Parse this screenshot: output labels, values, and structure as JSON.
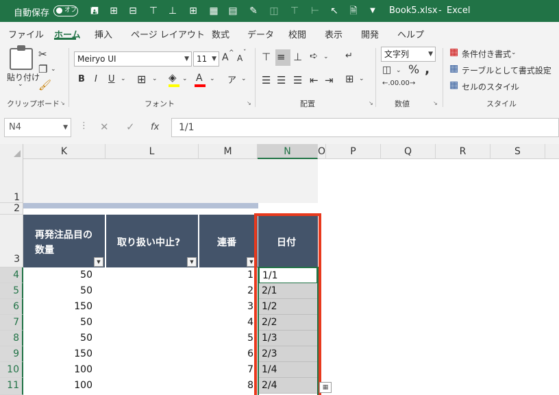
{
  "titlebar": {
    "autosave_label": "自動保存",
    "autosave_state": "オフ",
    "filename": "Book5.xlsx",
    "separator": "-",
    "app": "Excel"
  },
  "tabs": [
    "ファイル",
    "ホーム",
    "挿入",
    "ページ レイアウト",
    "数式",
    "データ",
    "校閲",
    "表示",
    "開発",
    "ヘルプ"
  ],
  "active_tab": "ホーム",
  "ribbon": {
    "clipboard": {
      "label": "クリップボード",
      "paste": "貼り付け"
    },
    "font": {
      "label": "フォント",
      "family": "Meiryo UI",
      "size": "11",
      "bold": "B",
      "italic": "I",
      "underline": "U",
      "grow": "A",
      "shrink": "A"
    },
    "alignment": {
      "label": "配置"
    },
    "number": {
      "label": "数値",
      "format": "文字列",
      "percent": "%",
      "comma": ","
    },
    "styles": {
      "label": "スタイル",
      "conditional": "条件付き書式",
      "as_table": "テーブルとして書式設定",
      "cell_styles": "セルのスタイル"
    }
  },
  "formula_bar": {
    "name_box": "N4",
    "fx": "fx",
    "value": "1/1"
  },
  "columns": [
    {
      "id": "K",
      "selected": false
    },
    {
      "id": "L",
      "selected": false
    },
    {
      "id": "M",
      "selected": false
    },
    {
      "id": "N",
      "selected": true
    },
    {
      "id": "O",
      "selected": false
    },
    {
      "id": "P",
      "selected": false
    },
    {
      "id": "Q",
      "selected": false
    },
    {
      "id": "R",
      "selected": false
    },
    {
      "id": "S",
      "selected": false
    }
  ],
  "rows": [
    "1",
    "2",
    "3",
    "4",
    "5",
    "6",
    "7",
    "8",
    "9",
    "10",
    "11"
  ],
  "table": {
    "headers": {
      "col_k_line1": "再発注品目の",
      "col_k_line2": "数量",
      "col_l": "取り扱い中止?",
      "col_m": "連番",
      "col_n": "日付"
    },
    "data": [
      {
        "qty": "50",
        "seq": "1",
        "date": "1/1"
      },
      {
        "qty": "50",
        "seq": "2",
        "date": "2/1"
      },
      {
        "qty": "150",
        "seq": "3",
        "date": "1/2"
      },
      {
        "qty": "50",
        "seq": "4",
        "date": "2/2"
      },
      {
        "qty": "50",
        "seq": "5",
        "date": "1/3"
      },
      {
        "qty": "150",
        "seq": "6",
        "date": "2/3"
      },
      {
        "qty": "100",
        "seq": "7",
        "date": "1/4"
      },
      {
        "qty": "100",
        "seq": "8",
        "date": "2/4"
      }
    ]
  },
  "colors": {
    "excel_green": "#217346",
    "table_header": "#44546a",
    "highlight": "#e8391d",
    "selection": "#d3d3d3"
  }
}
